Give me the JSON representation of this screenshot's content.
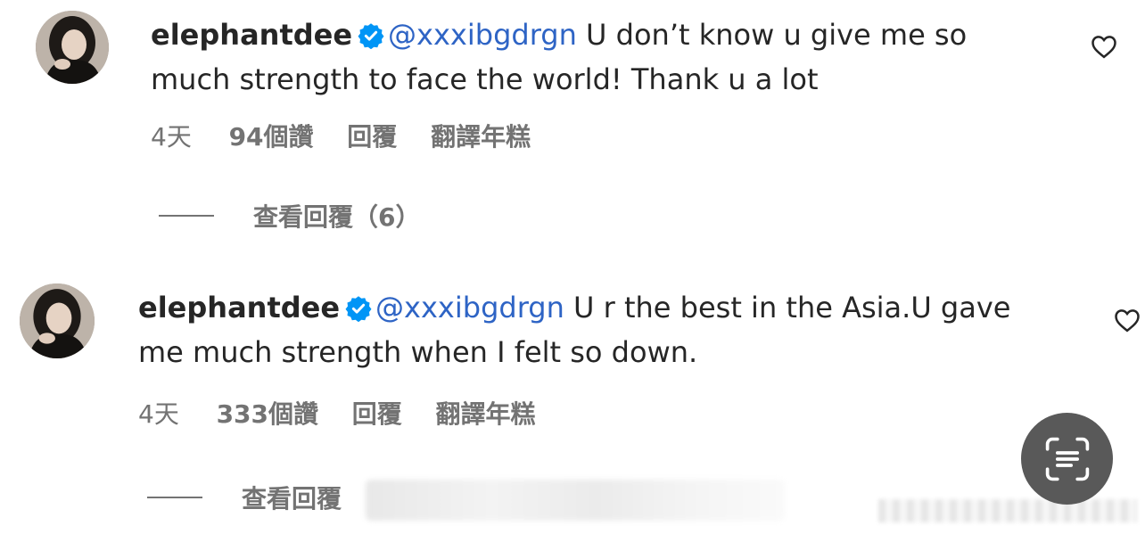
{
  "comments": [
    {
      "username": "elephantdee",
      "mention": "@xxxibgdrgn",
      "text_line1": " U don’t know u give me so",
      "text_line2": "much strength to face the world! Thank u a lot",
      "time": "4天",
      "likes": "94個讚",
      "reply": "回覆",
      "translate": "翻譯年糕",
      "view_replies": "查看回覆（6）"
    },
    {
      "username": "elephantdee",
      "mention": "@xxxibgdrgn",
      "text_line1": " U r the best in the Asia.U gave",
      "text_line2": "me much strength when I felt so down.",
      "time": "4天",
      "likes": "333個讚",
      "reply": "回覆",
      "translate": "翻譯年糕",
      "view_replies": "查看回覆"
    }
  ],
  "colors": {
    "mention": "#2e64c5",
    "verified": "#0095f6",
    "meta": "#737373",
    "text": "#262626"
  },
  "icons": {
    "like": "heart-outline-icon",
    "verified": "verified-badge-icon",
    "scan": "text-scan-icon"
  }
}
